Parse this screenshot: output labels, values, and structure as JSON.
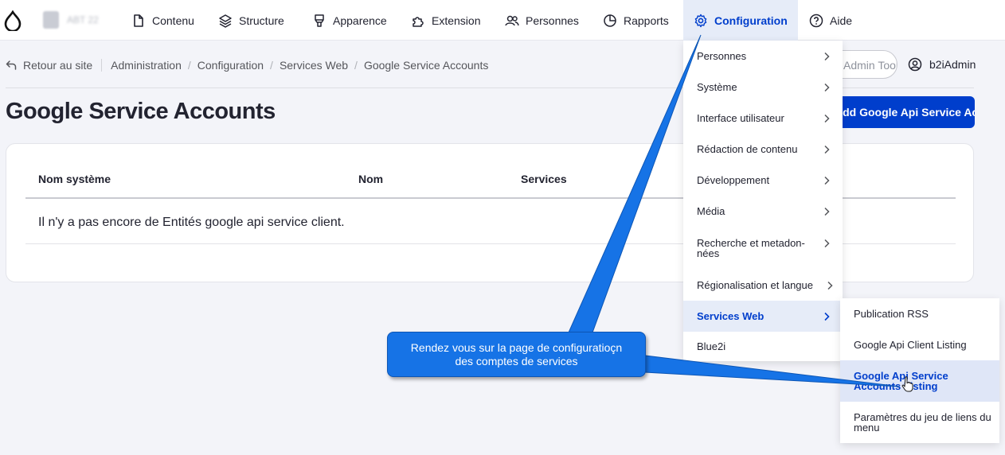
{
  "toolbar": {
    "items": [
      {
        "label": "Contenu",
        "icon": "file-icon"
      },
      {
        "label": "Structure",
        "icon": "layers-icon"
      },
      {
        "label": "Apparence",
        "icon": "paint-brush-icon"
      },
      {
        "label": "Extension",
        "icon": "puzzle-icon"
      },
      {
        "label": "Personnes",
        "icon": "people-icon"
      },
      {
        "label": "Rapports",
        "icon": "pie-chart-icon"
      },
      {
        "label": "Configuration",
        "icon": "gear-icon"
      },
      {
        "label": "Aide",
        "icon": "help-icon"
      }
    ],
    "active": "Configuration"
  },
  "breadcrumb": {
    "back_label": "Retour au site",
    "items": [
      "Administration",
      "Configuration",
      "Services Web",
      "Google Service Accounts"
    ]
  },
  "admin_toolbar_label": "Admin Toolbar",
  "user_name": "b2iAdmin",
  "page_title": "Google Service Accounts",
  "add_button_label": "Add Google Api Service Account",
  "table": {
    "headers": [
      "Nom système",
      "Nom",
      "Services"
    ],
    "empty_message": "Il n'y a pas encore de Entités google api service client."
  },
  "menu": {
    "items": [
      {
        "label": "Personnes",
        "has_children": true
      },
      {
        "label": "Système",
        "has_children": true
      },
      {
        "label": "Interface utilisateur",
        "has_children": true
      },
      {
        "label": "Rédaction de contenu",
        "has_children": true
      },
      {
        "label": "Développement",
        "has_children": true
      },
      {
        "label": "Média",
        "has_children": true
      },
      {
        "label": "Recherche et metadon-nées",
        "has_children": true
      },
      {
        "label": "Régionalisation et langue",
        "has_children": true
      },
      {
        "label": "Services Web",
        "has_children": true
      },
      {
        "label": "Blue2i",
        "has_children": false
      }
    ],
    "active": "Services Web"
  },
  "submenu": {
    "items": [
      {
        "label": "Publication RSS"
      },
      {
        "label": "Google Api Client Listing"
      },
      {
        "label": "Google Api Service Accounts Listing"
      },
      {
        "label": "Paramètres du jeu de liens du menu"
      }
    ],
    "active": "Google Api Service Accounts Listing"
  },
  "callout": {
    "line1": "Rendez vous sur la page de configuratioçn",
    "line2": "des comptes de services"
  },
  "colors": {
    "accent": "#003ecc",
    "callout": "#1673e6",
    "active_bg": "#e6ecf8"
  }
}
